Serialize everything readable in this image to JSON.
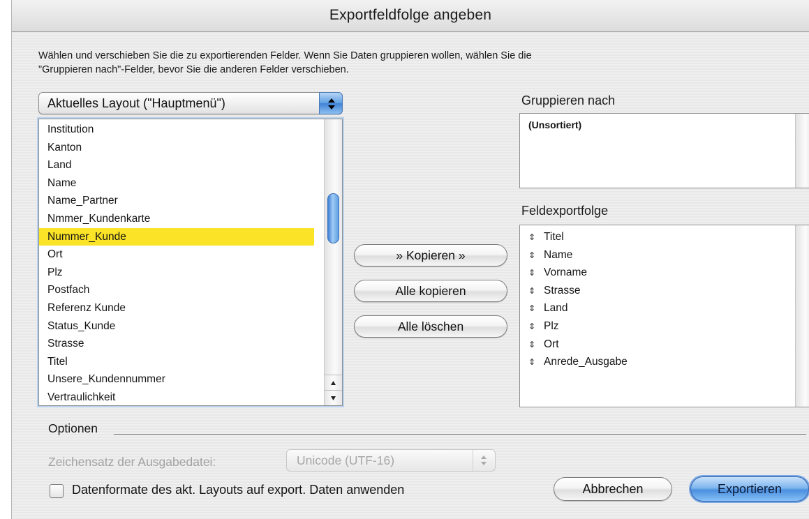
{
  "dialog": {
    "title": "Exportfeldfolge angeben",
    "instructions_line1": "Wählen und verschieben Sie die zu exportierenden Felder.  Wenn Sie Daten gruppieren wollen, wählen Sie die",
    "instructions_line2": "\"Gruppieren nach\"-Felder, bevor Sie die anderen Felder verschieben."
  },
  "source": {
    "layout_popup_value": "Aktuelles Layout (\"Hauptmenü\")",
    "fields": [
      "Institution",
      "Kanton",
      "Land",
      "Name",
      "Name_Partner",
      "Nmmer_Kundenkarte",
      "Nummer_Kunde",
      "Ort",
      "Plz",
      "Postfach",
      "Referenz Kunde",
      "Status_Kunde",
      "Strasse",
      "Titel",
      "Unsere_Kundennummer",
      "Vertraulichkeit"
    ],
    "selected_field": "Nummer_Kunde"
  },
  "actions": {
    "copy_label": "» Kopieren »",
    "copy_all_label": "Alle kopieren",
    "clear_all_label": "Alle löschen"
  },
  "group_by": {
    "label": "Gruppieren nach",
    "value": "(Unsortiert)"
  },
  "export_order": {
    "label": "Feldexportfolge",
    "fields": [
      "Titel",
      "Name",
      "Vorname",
      "Strasse",
      "Land",
      "Plz",
      "Ort",
      "Anrede_Ausgabe"
    ]
  },
  "options": {
    "label": "Optionen",
    "charset_label": "Zeichensatz der Ausgabedatei:",
    "charset_value": "Unicode (UTF-16)",
    "apply_formats_label": "Datenformate des akt. Layouts auf export. Daten anwenden",
    "apply_formats_checked": false
  },
  "footer": {
    "cancel_label": "Abbrechen",
    "export_label": "Exportieren"
  },
  "colors": {
    "selection": "#fbe327",
    "accent_blue": "#4c8fe0",
    "dialog_bg": "#ececec"
  }
}
